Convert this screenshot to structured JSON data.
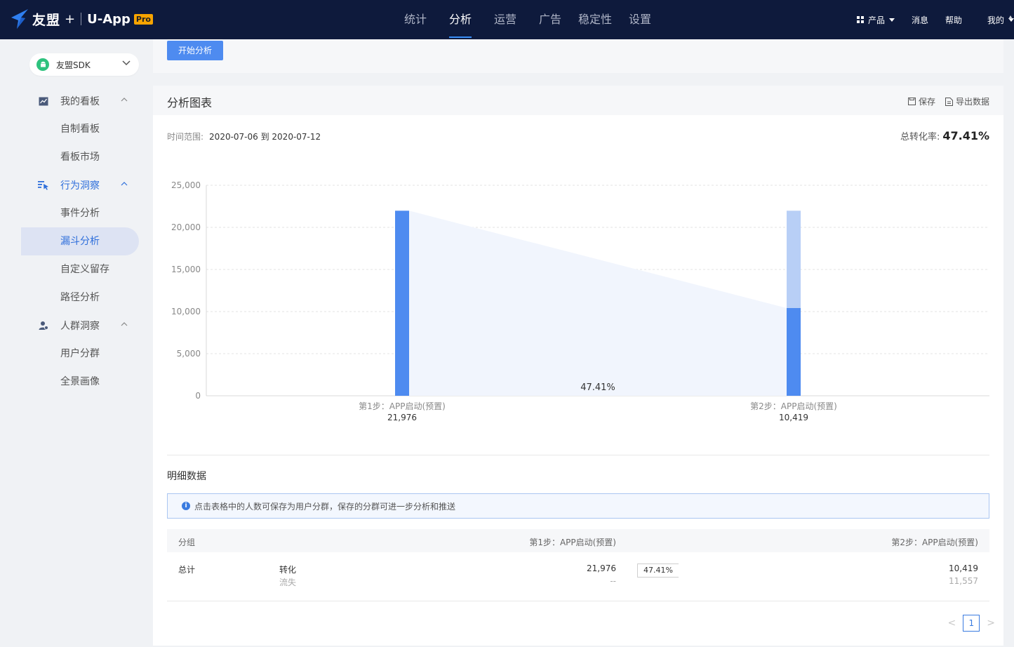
{
  "header": {
    "brand": "友盟",
    "plus": "+",
    "product": "U-App",
    "badge": "Pro",
    "nav": [
      {
        "label": "统计",
        "active": false
      },
      {
        "label": "分析",
        "active": true
      },
      {
        "label": "运营",
        "active": false
      },
      {
        "label": "广告",
        "active": false
      },
      {
        "label": "稳定性",
        "active": false
      },
      {
        "label": "设置",
        "active": false
      }
    ],
    "right": {
      "products": "产品",
      "messages": "消息",
      "help": "帮助",
      "mine": "我的"
    }
  },
  "sidebar": {
    "app_selector": "友盟SDK",
    "groups": [
      {
        "label": "我的看板",
        "icon": "chart-line-icon",
        "items": [
          "自制看板",
          "看板市场"
        ]
      },
      {
        "label": "行为洞察",
        "icon": "behavior-icon",
        "items": [
          "事件分析",
          "漏斗分析",
          "自定义留存",
          "路径分析"
        ]
      },
      {
        "label": "人群洞察",
        "icon": "user-group-icon",
        "items": [
          "用户分群",
          "全景画像"
        ]
      }
    ],
    "active_item": "漏斗分析"
  },
  "toolbar": {
    "start_label": "开始分析"
  },
  "chart_card": {
    "title": "分析图表",
    "save_label": "保存",
    "export_label": "导出数据",
    "time_range_label": "时间范围:",
    "time_range_value": "2020-07-06 到 2020-07-12",
    "total_rate_label": "总转化率:",
    "total_rate_value": "47.41%"
  },
  "chart_data": {
    "type": "bar",
    "categories": [
      "第1步：APP启动(预置)",
      "第2步：APP启动(预置)"
    ],
    "values": [
      21976,
      10419
    ],
    "value_labels": [
      "21,976",
      "10,419"
    ],
    "reference_value": 21976,
    "conversion_label": "47.41%",
    "ylim": [
      0,
      25000
    ],
    "yticks": [
      0,
      5000,
      10000,
      15000,
      20000,
      25000
    ],
    "ytick_labels": [
      "0",
      "5,000",
      "10,000",
      "15,000",
      "20,000",
      "25,000"
    ],
    "grid": true,
    "colors": {
      "bar": "#4e8bf0",
      "lost": "#b8cff6",
      "area": "#f1f5fd"
    }
  },
  "detail": {
    "title": "明细数据",
    "info": "点击表格中的人数可保存为用户分群，保存的分群可进一步分析和推送",
    "columns": [
      "分组",
      "第1步：APP启动(预置)",
      "第2步：APP启动(预置)"
    ],
    "rows": [
      {
        "group": "总计",
        "convert_label": "转化",
        "lost_label": "流失",
        "step1_convert": "21,976",
        "step1_lost": "--",
        "rate": "47.41%",
        "step2_convert": "10,419",
        "step2_lost": "11,557"
      }
    ]
  },
  "pagination": {
    "prev": "<",
    "page": "1",
    "next": ">"
  }
}
